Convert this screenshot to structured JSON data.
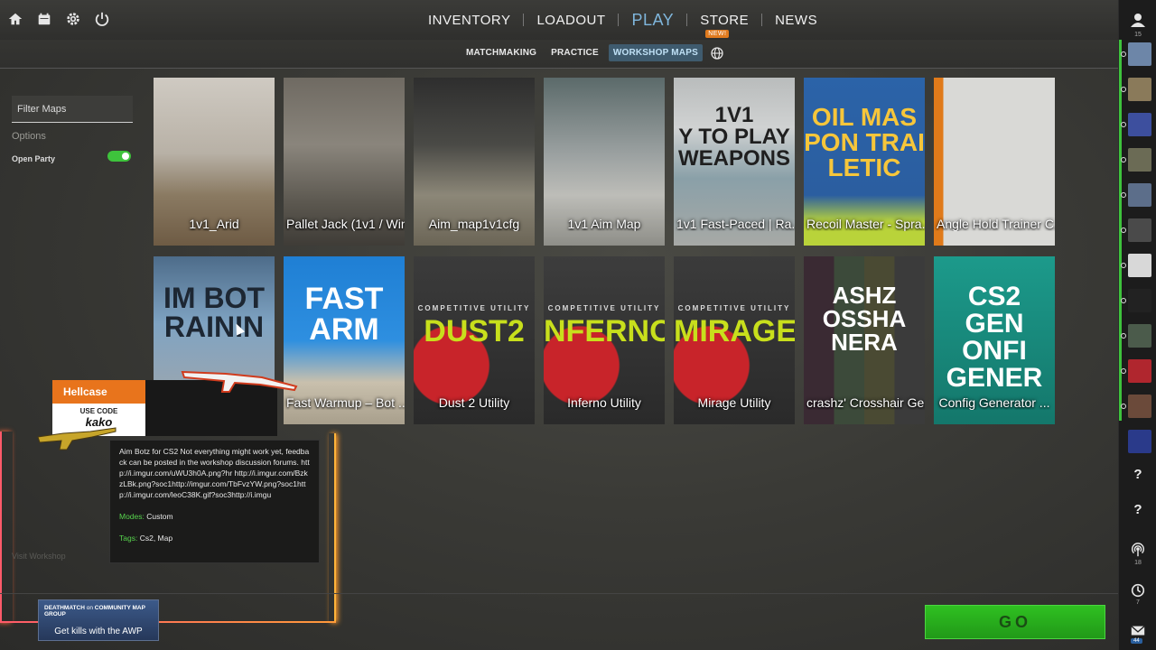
{
  "top_icons": [
    "home-icon",
    "calendar-icon",
    "gear-icon",
    "power-icon"
  ],
  "main_nav": {
    "inventory": "INVENTORY",
    "loadout": "LOADOUT",
    "play": "PLAY",
    "store": "STORE",
    "store_badge": "NEW!",
    "news": "NEWS"
  },
  "sub_nav": {
    "matchmaking": "MATCHMAKING",
    "practice": "PRACTICE",
    "workshop_maps": "WORKSHOP MAPS"
  },
  "left_panel": {
    "filter_placeholder": "Filter Maps",
    "options_title": "Options",
    "open_party_label": "Open Party",
    "open_party_on": true,
    "visit_workshop": "Visit Workshop"
  },
  "maps": [
    {
      "title": "1v1_Arid"
    },
    {
      "title": "Pallet Jack (1v1 / Win..."
    },
    {
      "title": "Aim_map1v1cfg"
    },
    {
      "title": "1v1 Aim Map"
    },
    {
      "title": "1v1 Fast-Paced | Ra...",
      "art_text": "1V1\nY TO PLAY\nWEAPONS"
    },
    {
      "title": "Recoil Master - Spra...",
      "art_text": "OIL MAS\nPON TRAI\nLETIC"
    },
    {
      "title": "Angle Hold Trainer C..."
    },
    {
      "title": "",
      "art_text": "IM BOT\nRAININ"
    },
    {
      "title": "Fast Warmup – Bot ...",
      "art_text": "FAST\nARM"
    },
    {
      "title": "Dust 2 Utility",
      "art_text": "DUST2",
      "subtitle": "COMPETITIVE UTILITY"
    },
    {
      "title": "Inferno Utility",
      "art_text": "NFERNO",
      "subtitle": "COMPETITIVE UTILITY"
    },
    {
      "title": "Mirage Utility",
      "art_text": "MIRAGE",
      "subtitle": "COMPETITIVE UTILITY"
    },
    {
      "title": "crashz' Crosshair Ge...",
      "art_text": "ASHZ\nOSSHA\nNERA"
    },
    {
      "title": "Config Generator ...",
      "art_text": "CS2\nGEN\nONFI\nGENER"
    }
  ],
  "tooltip": {
    "description": "Aim Botz for CS2 Not everything might work yet, feedback can be posted in the workshop discussion forums. http://i.imgur.com/uWU3h0A.png?hr http://i.imgur.com/BzkzLBk.png?soc1http://imgur.com/TbFvzYW.png?soc1http://i.imgur.com/leoC38K.gif?soc3http://i.imgu",
    "modes_label": "Modes:",
    "modes_value": "Custom",
    "tags_label": "Tags:",
    "tags_value": "Cs2, Map"
  },
  "promo": {
    "brand": "Hellcase",
    "use_code": "USE CODE",
    "code": "kako"
  },
  "event_card": {
    "line1_a": "DEATHMATCH",
    "line1_b": "on",
    "line1_c": "COMMUNITY MAP GROUP",
    "line2": "Get kills with the AWP"
  },
  "go_button": "GO",
  "right_bar": {
    "friends_count": "15",
    "broadcast_count": "18",
    "history_count": "7",
    "mail_count": "44",
    "help": "?"
  },
  "colors": {
    "accent_blue": "#7fb6dc",
    "go_green": "#2fc021",
    "hellcase_orange": "#e8741c",
    "tooltip_key_green": "#57d34d"
  }
}
